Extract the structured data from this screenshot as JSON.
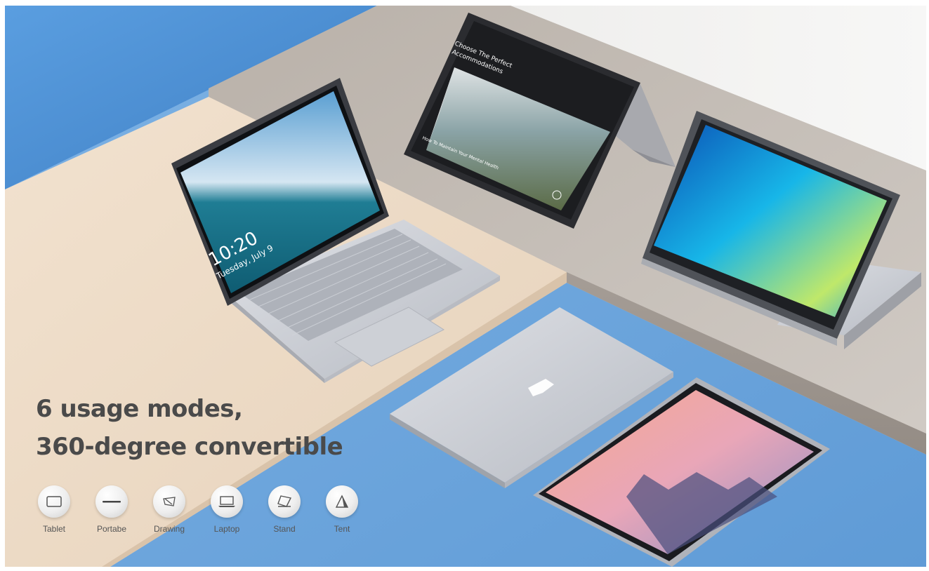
{
  "headline": {
    "line1": "6 usage modes,",
    "line2": "360-degree convertible"
  },
  "laptop_screen": {
    "time": "10:20",
    "date": "Tuesday, July 9"
  },
  "tent_screen": {
    "title_line1": "Choose The Perfect",
    "title_line2": "Accommodations",
    "caption": "How To Maintain Your Mental Health"
  },
  "modes": [
    {
      "label": "Tablet",
      "icon": "tablet-icon"
    },
    {
      "label": "Portabe",
      "icon": "portable-icon"
    },
    {
      "label": "Drawing",
      "icon": "drawing-icon"
    },
    {
      "label": "Laptop",
      "icon": "laptop-icon"
    },
    {
      "label": "Stand",
      "icon": "stand-icon"
    },
    {
      "label": "Tent",
      "icon": "tent-icon"
    }
  ],
  "colors": {
    "wall_blue": "#4f93d6",
    "floor_blue": "#6fa6dc",
    "beige_block": "#eedbc6",
    "grey_block": "#bdb4ac",
    "laptop_silver": "#c9ccd3",
    "headline_text": "#4a4a4a"
  }
}
